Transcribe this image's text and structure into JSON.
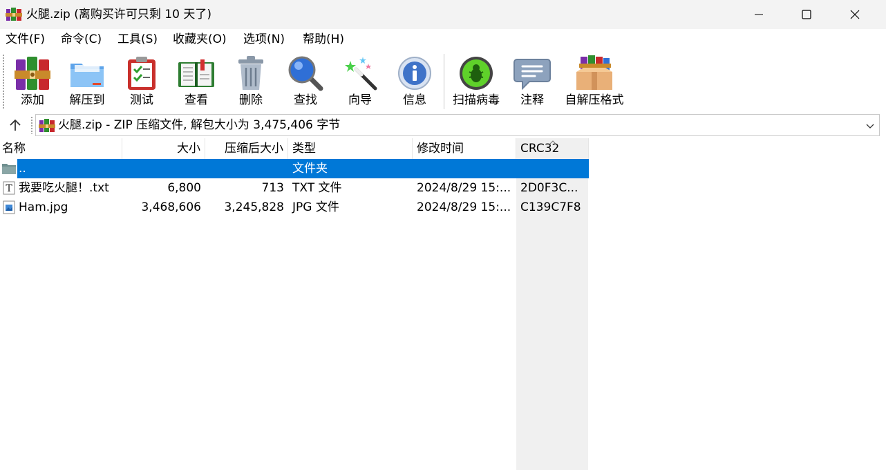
{
  "window": {
    "title": "火腿.zip (离购买许可只剩 10 天了)"
  },
  "menu": [
    "文件(F)",
    "命令(C)",
    "工具(S)",
    "收藏夹(O)",
    "选项(N)",
    "帮助(H)"
  ],
  "toolbar": {
    "add": "添加",
    "extract": "解压到",
    "test": "测试",
    "view": "查看",
    "delete": "删除",
    "find": "查找",
    "wizard": "向导",
    "info": "信息",
    "scan": "扫描病毒",
    "comment": "注释",
    "sfx": "自解压格式"
  },
  "address": {
    "text": "火腿.zip - ZIP 压缩文件, 解包大小为 3,475,406 字节"
  },
  "columns": {
    "name": "名称",
    "size": "大小",
    "packed": "压缩后大小",
    "type": "类型",
    "modified": "修改时间",
    "crc": "CRC32"
  },
  "rows": [
    {
      "name": "..",
      "size": "",
      "packed": "",
      "type": "文件夹",
      "modified": "",
      "crc": ""
    },
    {
      "name": "我要吃火腿！.txt",
      "size": "6,800",
      "packed": "713",
      "type": "TXT 文件",
      "modified": "2024/8/29 15:...",
      "crc": "2D0F3C..."
    },
    {
      "name": "Ham.jpg",
      "size": "3,468,606",
      "packed": "3,245,828",
      "type": "JPG 文件",
      "modified": "2024/8/29 15:...",
      "crc": "C139C7F8"
    }
  ],
  "colors": {
    "selection": "#0078d7",
    "titlebar": "#f3f3f3"
  }
}
